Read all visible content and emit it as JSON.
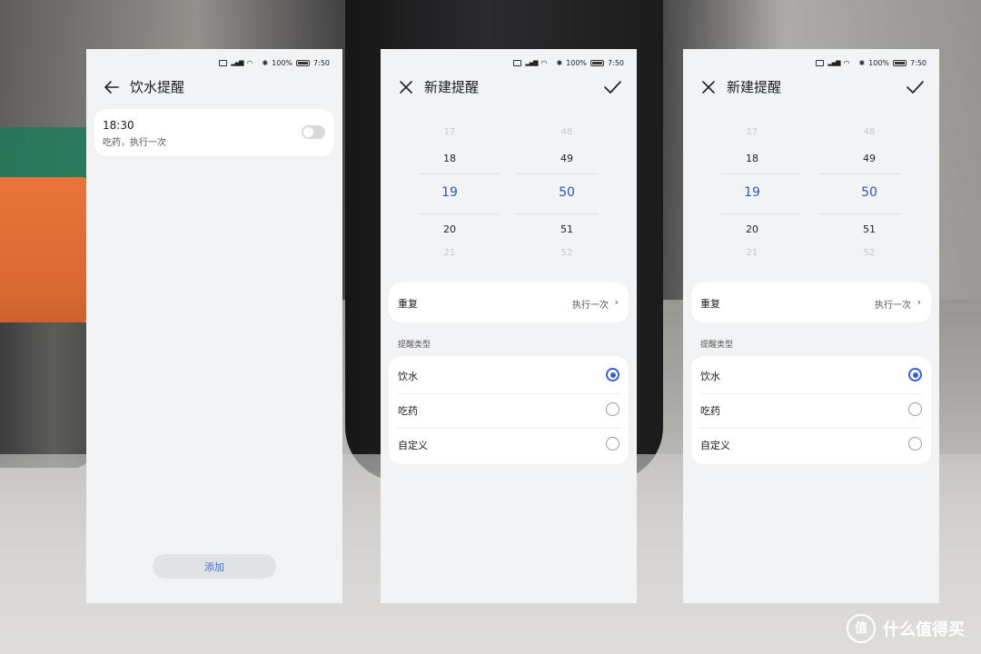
{
  "status_bar": {
    "battery": "100%",
    "time": "7:50"
  },
  "screen1": {
    "title": "饮水提醒",
    "alarm": {
      "time": "18:30",
      "subtitle": "吃药，执行一次",
      "enabled": false
    },
    "add_button": "添加"
  },
  "screen2": {
    "title": "新建提醒",
    "picker": {
      "hours": [
        "17",
        "18",
        "19",
        "20",
        "21"
      ],
      "minutes": [
        "48",
        "49",
        "50",
        "51",
        "52"
      ],
      "selected_hour": "19",
      "selected_minute": "50"
    },
    "repeat": {
      "label": "重复",
      "value": "执行一次"
    },
    "type_section": "提醒类型",
    "types": [
      {
        "label": "饮水",
        "selected": true
      },
      {
        "label": "吃药",
        "selected": false
      },
      {
        "label": "自定义",
        "selected": false
      }
    ]
  },
  "screen3": {
    "title": "新建提醒",
    "picker": {
      "hours": [
        "17",
        "18",
        "19",
        "20",
        "21"
      ],
      "minutes": [
        "48",
        "49",
        "50",
        "51",
        "52"
      ],
      "selected_hour": "19",
      "selected_minute": "50"
    },
    "repeat": {
      "label": "重复",
      "value": "执行一次"
    },
    "type_section": "提醒类型",
    "types": [
      {
        "label": "饮水",
        "selected": true
      },
      {
        "label": "吃药",
        "selected": false
      },
      {
        "label": "自定义",
        "selected": false
      }
    ]
  },
  "watermark": {
    "logo": "值",
    "text": "什么值得买"
  },
  "colors": {
    "accent": "#3a5fcd",
    "picker_selected": "#2e57b8",
    "add_text": "#3c6ed4"
  }
}
